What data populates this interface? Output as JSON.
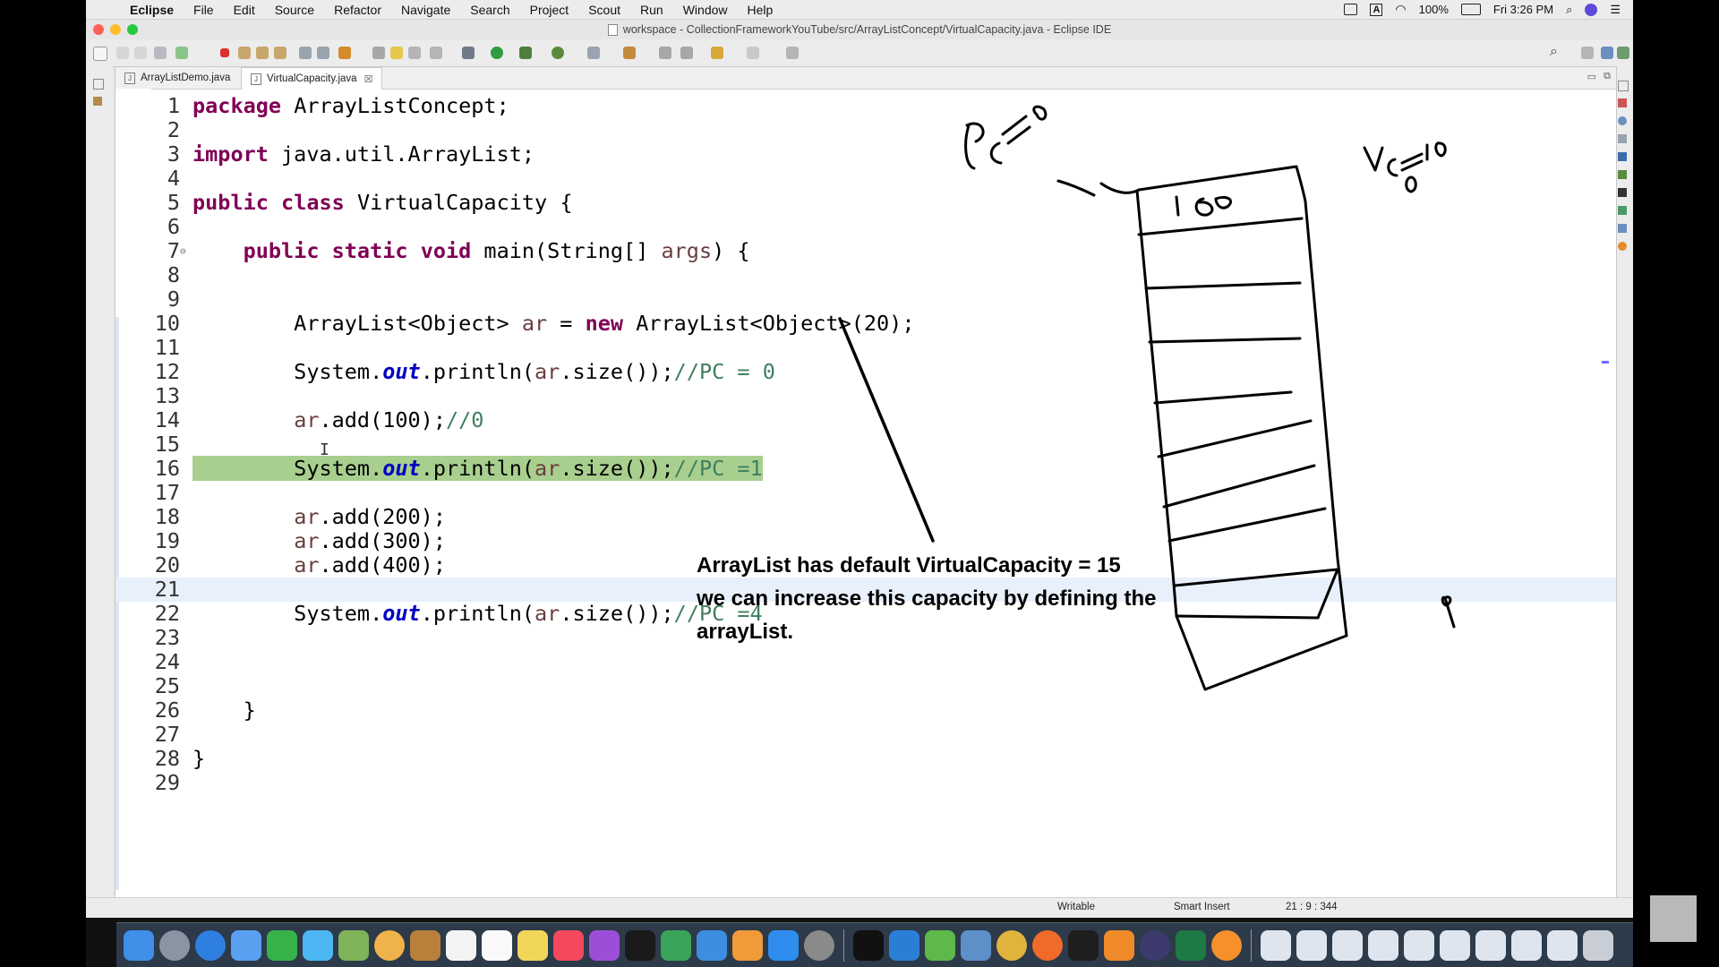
{
  "menubar": {
    "app": "Eclipse",
    "items": [
      "File",
      "Edit",
      "Source",
      "Refactor",
      "Navigate",
      "Search",
      "Project",
      "Scout",
      "Run",
      "Window",
      "Help"
    ],
    "battery": "100%",
    "clock": "Fri 3:26 PM"
  },
  "window": {
    "title": "workspace - CollectionFrameworkYouTube/src/ArrayListConcept/VirtualCapacity.java - Eclipse IDE"
  },
  "tabs": [
    {
      "label": "ArrayListDemo.java"
    },
    {
      "label": "VirtualCapacity.java"
    }
  ],
  "editor": {
    "lines": [
      "1",
      "2",
      "3",
      "4",
      "5",
      "6",
      "7",
      "8",
      "9",
      "10",
      "11",
      "12",
      "13",
      "14",
      "15",
      "16",
      "17",
      "18",
      "19",
      "20",
      "21",
      "22",
      "23",
      "24",
      "25",
      "26",
      "27",
      "28",
      "29"
    ]
  },
  "overlay": {
    "line1": "ArrayList has default VirtualCapacity = 15",
    "line2": "we can increase this capacity by defining the",
    "line3": "arrayList."
  },
  "status": {
    "writable": "Writable",
    "insert_mode": "Smart Insert",
    "position": "21 : 9 : 344"
  }
}
